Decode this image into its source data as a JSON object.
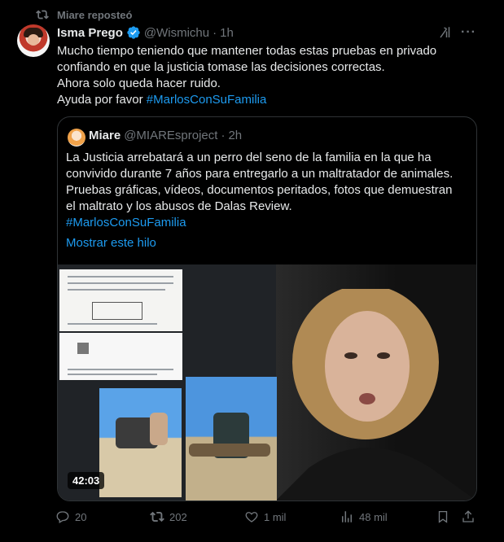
{
  "repost": {
    "label": "Miare reposteó"
  },
  "tweet": {
    "author_name": "Isma Prego",
    "handle": "@Wismichu",
    "separator": "·",
    "time": "1h",
    "text_lines": [
      "Mucho tiempo teniendo que mantener todas estas pruebas en privado",
      "confiando en que la justicia tomase las decisiones correctas.",
      "Ahora solo queda hacer ruido."
    ],
    "last_line_prefix": "Ayuda por favor ",
    "hashtag": "#MarlosConSuFamilia",
    "more_label": "···"
  },
  "quote": {
    "author_name": "Miare",
    "handle": "@MIAREsproject",
    "separator": "·",
    "time": "2h",
    "text_lines": [
      "La Justicia arrebatará a un perro del seno de la familia en la que ha",
      "convivido durante 7 años para entregarlo a un maltratador de animales.",
      "Pruebas gráficas, vídeos, documentos peritados, fotos que demuestran",
      "el maltrato y los abusos de Dalas Review."
    ],
    "hashtag": "#MarlosConSuFamilia",
    "show_thread": "Mostrar este hilo",
    "video_duration": "42:03"
  },
  "actions": {
    "replies": "20",
    "reposts": "202",
    "likes": "1 mil",
    "views": "48 mil"
  },
  "colors": {
    "background": "#000000",
    "text": "#e7e9ea",
    "muted": "#71767b",
    "accent": "#1d9bf0",
    "border": "#2f3336"
  }
}
